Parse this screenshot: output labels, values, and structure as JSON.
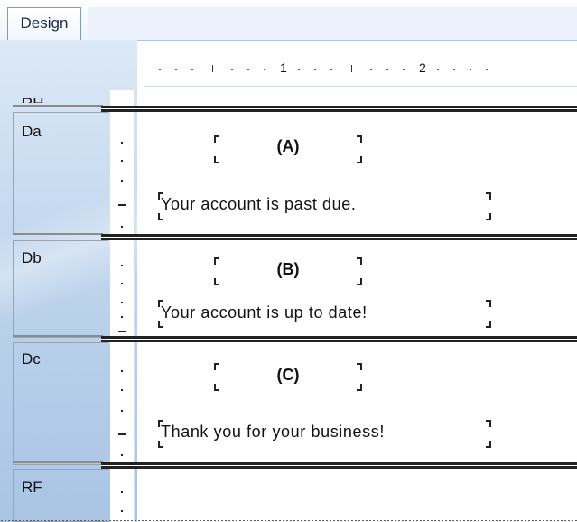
{
  "tabs": {
    "design_label": "Design"
  },
  "ruler": {
    "marks": [
      "1",
      "2"
    ]
  },
  "bands": {
    "partial_label": "RH",
    "da": {
      "label": "Da",
      "title": "(A)",
      "text": "Your account is past due."
    },
    "db": {
      "label": "Db",
      "title": "(B)",
      "text": "Your account is up to date!"
    },
    "dc": {
      "label": "Dc",
      "title": "(C)",
      "text": "Thank you for your business!"
    },
    "rf": {
      "label": "RF"
    }
  }
}
